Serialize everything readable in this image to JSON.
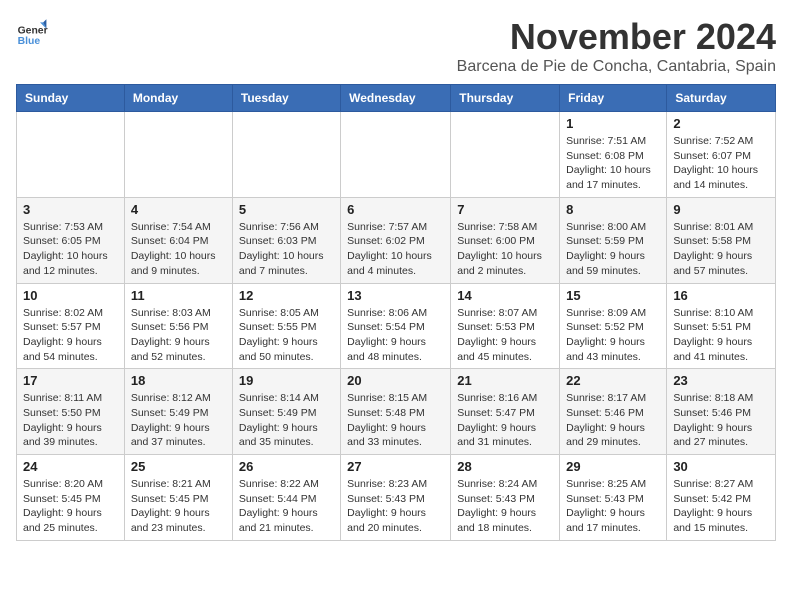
{
  "logo": {
    "line1": "General",
    "line2": "Blue"
  },
  "title": "November 2024",
  "location": "Barcena de Pie de Concha, Cantabria, Spain",
  "weekdays": [
    "Sunday",
    "Monday",
    "Tuesday",
    "Wednesday",
    "Thursday",
    "Friday",
    "Saturday"
  ],
  "weeks": [
    [
      {
        "day": "",
        "info": ""
      },
      {
        "day": "",
        "info": ""
      },
      {
        "day": "",
        "info": ""
      },
      {
        "day": "",
        "info": ""
      },
      {
        "day": "",
        "info": ""
      },
      {
        "day": "1",
        "info": "Sunrise: 7:51 AM\nSunset: 6:08 PM\nDaylight: 10 hours and 17 minutes."
      },
      {
        "day": "2",
        "info": "Sunrise: 7:52 AM\nSunset: 6:07 PM\nDaylight: 10 hours and 14 minutes."
      }
    ],
    [
      {
        "day": "3",
        "info": "Sunrise: 7:53 AM\nSunset: 6:05 PM\nDaylight: 10 hours and 12 minutes."
      },
      {
        "day": "4",
        "info": "Sunrise: 7:54 AM\nSunset: 6:04 PM\nDaylight: 10 hours and 9 minutes."
      },
      {
        "day": "5",
        "info": "Sunrise: 7:56 AM\nSunset: 6:03 PM\nDaylight: 10 hours and 7 minutes."
      },
      {
        "day": "6",
        "info": "Sunrise: 7:57 AM\nSunset: 6:02 PM\nDaylight: 10 hours and 4 minutes."
      },
      {
        "day": "7",
        "info": "Sunrise: 7:58 AM\nSunset: 6:00 PM\nDaylight: 10 hours and 2 minutes."
      },
      {
        "day": "8",
        "info": "Sunrise: 8:00 AM\nSunset: 5:59 PM\nDaylight: 9 hours and 59 minutes."
      },
      {
        "day": "9",
        "info": "Sunrise: 8:01 AM\nSunset: 5:58 PM\nDaylight: 9 hours and 57 minutes."
      }
    ],
    [
      {
        "day": "10",
        "info": "Sunrise: 8:02 AM\nSunset: 5:57 PM\nDaylight: 9 hours and 54 minutes."
      },
      {
        "day": "11",
        "info": "Sunrise: 8:03 AM\nSunset: 5:56 PM\nDaylight: 9 hours and 52 minutes."
      },
      {
        "day": "12",
        "info": "Sunrise: 8:05 AM\nSunset: 5:55 PM\nDaylight: 9 hours and 50 minutes."
      },
      {
        "day": "13",
        "info": "Sunrise: 8:06 AM\nSunset: 5:54 PM\nDaylight: 9 hours and 48 minutes."
      },
      {
        "day": "14",
        "info": "Sunrise: 8:07 AM\nSunset: 5:53 PM\nDaylight: 9 hours and 45 minutes."
      },
      {
        "day": "15",
        "info": "Sunrise: 8:09 AM\nSunset: 5:52 PM\nDaylight: 9 hours and 43 minutes."
      },
      {
        "day": "16",
        "info": "Sunrise: 8:10 AM\nSunset: 5:51 PM\nDaylight: 9 hours and 41 minutes."
      }
    ],
    [
      {
        "day": "17",
        "info": "Sunrise: 8:11 AM\nSunset: 5:50 PM\nDaylight: 9 hours and 39 minutes."
      },
      {
        "day": "18",
        "info": "Sunrise: 8:12 AM\nSunset: 5:49 PM\nDaylight: 9 hours and 37 minutes."
      },
      {
        "day": "19",
        "info": "Sunrise: 8:14 AM\nSunset: 5:49 PM\nDaylight: 9 hours and 35 minutes."
      },
      {
        "day": "20",
        "info": "Sunrise: 8:15 AM\nSunset: 5:48 PM\nDaylight: 9 hours and 33 minutes."
      },
      {
        "day": "21",
        "info": "Sunrise: 8:16 AM\nSunset: 5:47 PM\nDaylight: 9 hours and 31 minutes."
      },
      {
        "day": "22",
        "info": "Sunrise: 8:17 AM\nSunset: 5:46 PM\nDaylight: 9 hours and 29 minutes."
      },
      {
        "day": "23",
        "info": "Sunrise: 8:18 AM\nSunset: 5:46 PM\nDaylight: 9 hours and 27 minutes."
      }
    ],
    [
      {
        "day": "24",
        "info": "Sunrise: 8:20 AM\nSunset: 5:45 PM\nDaylight: 9 hours and 25 minutes."
      },
      {
        "day": "25",
        "info": "Sunrise: 8:21 AM\nSunset: 5:45 PM\nDaylight: 9 hours and 23 minutes."
      },
      {
        "day": "26",
        "info": "Sunrise: 8:22 AM\nSunset: 5:44 PM\nDaylight: 9 hours and 21 minutes."
      },
      {
        "day": "27",
        "info": "Sunrise: 8:23 AM\nSunset: 5:43 PM\nDaylight: 9 hours and 20 minutes."
      },
      {
        "day": "28",
        "info": "Sunrise: 8:24 AM\nSunset: 5:43 PM\nDaylight: 9 hours and 18 minutes."
      },
      {
        "day": "29",
        "info": "Sunrise: 8:25 AM\nSunset: 5:43 PM\nDaylight: 9 hours and 17 minutes."
      },
      {
        "day": "30",
        "info": "Sunrise: 8:27 AM\nSunset: 5:42 PM\nDaylight: 9 hours and 15 minutes."
      }
    ]
  ]
}
